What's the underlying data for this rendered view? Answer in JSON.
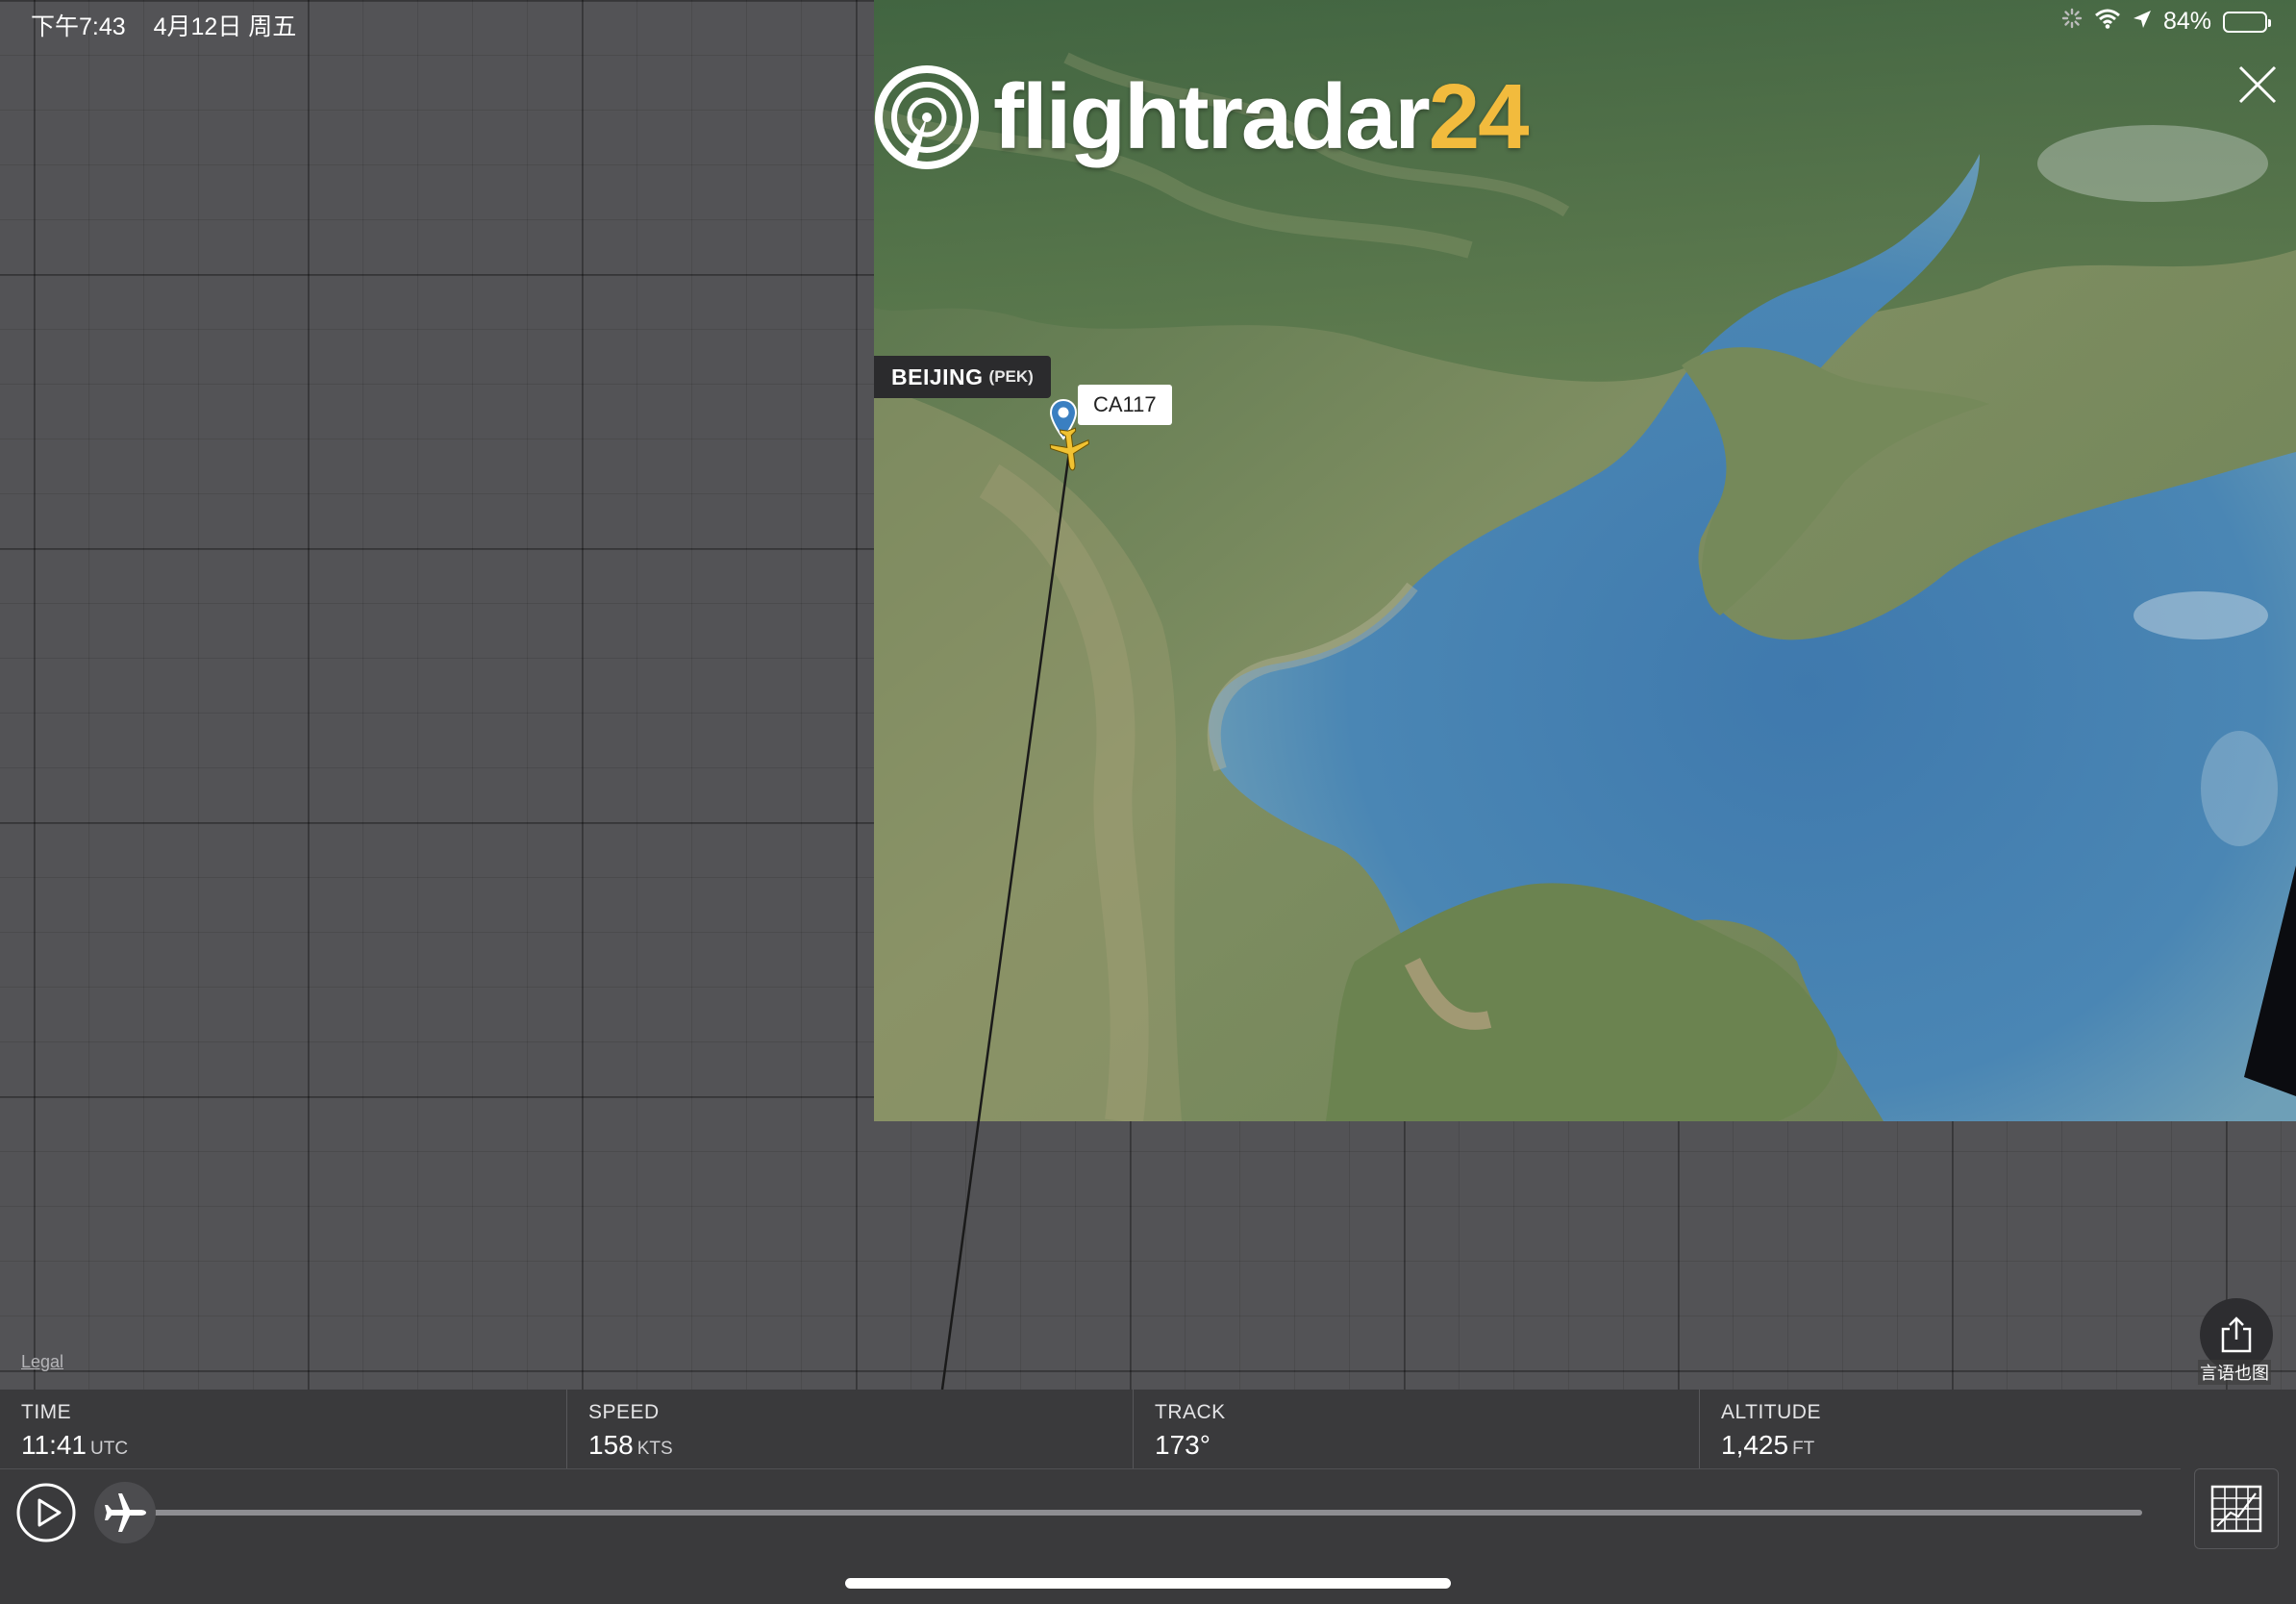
{
  "status_bar": {
    "time": "下午7:43",
    "date": "4月12日 周五",
    "battery": "84%",
    "battery_level": 0.84
  },
  "app": {
    "logo_main": "flightradar",
    "logo_accent": "24",
    "accent_color": "#f2bb3d"
  },
  "map": {
    "airport_name": "BEIJING",
    "airport_code": "(PEK)",
    "callsign": "CA117",
    "legal": "Legal",
    "share_caption": "言语也图",
    "icons": [
      "close-icon",
      "location-pin-icon",
      "airplane-icon",
      "share-icon"
    ]
  },
  "stats": {
    "time": {
      "label": "TIME",
      "value": "11:41",
      "unit": "UTC"
    },
    "speed": {
      "label": "SPEED",
      "value": "158",
      "unit": "KTS"
    },
    "track": {
      "label": "TRACK",
      "value": "173°",
      "unit": ""
    },
    "altitude": {
      "label": "ALTITUDE",
      "value": "1,425",
      "unit": "FT"
    }
  },
  "playback": {
    "position": 0.0,
    "icons": [
      "play-icon",
      "airplane-icon",
      "map-grid-icon"
    ]
  }
}
